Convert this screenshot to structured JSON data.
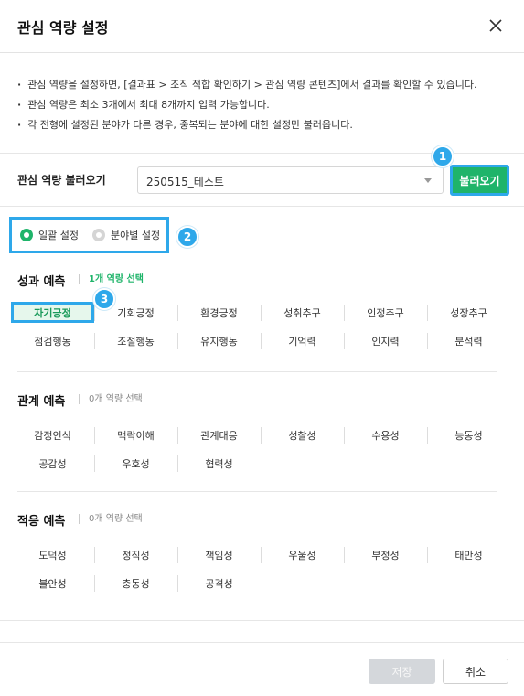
{
  "dialog": {
    "title": "관심 역량 설정"
  },
  "notes": [
    "관심 역량을 설정하면, [결과표 > 조직 적합 확인하기 > 관심 역량 콘텐츠]에서 결과를 확인할 수 있습니다.",
    "관심 역량은 최소 3개에서 최대 8개까지 입력 가능합니다.",
    "각 전형에 설정된 분야가 다른 경우, 중복되는 분야에 대한 설정만 불러옵니다."
  ],
  "load": {
    "label": "관심 역량 불러오기",
    "selected": "250515_테스트",
    "button": "불러오기"
  },
  "mode": {
    "options": [
      {
        "label": "일괄 설정",
        "selected": true
      },
      {
        "label": "분야별 설정",
        "selected": false
      }
    ]
  },
  "sections": [
    {
      "title": "성과 예측",
      "count": "1개 역량 선택",
      "items": [
        "자기긍정",
        "기회긍정",
        "환경긍정",
        "성취추구",
        "인정추구",
        "성장추구",
        "점검행동",
        "조절행동",
        "유지행동",
        "기억력",
        "인지력",
        "분석력"
      ],
      "selected": [
        "자기긍정"
      ]
    },
    {
      "title": "관계 예측",
      "count": "0개 역량 선택",
      "items": [
        "감정인식",
        "맥락이해",
        "관계대응",
        "성찰성",
        "수용성",
        "능동성",
        "공감성",
        "우호성",
        "협력성"
      ],
      "selected": []
    },
    {
      "title": "적응 예측",
      "count": "0개 역량 선택",
      "items": [
        "도덕성",
        "정직성",
        "책임성",
        "우울성",
        "부정성",
        "태만성",
        "불안성",
        "충동성",
        "공격성"
      ],
      "selected": []
    }
  ],
  "annotations": [
    "1",
    "2",
    "3"
  ],
  "footer": {
    "save": "저장",
    "cancel": "취소"
  },
  "colors": {
    "accent": "#1fb46a",
    "highlight": "#2ea8ea",
    "disabled": "#d4d7db"
  }
}
